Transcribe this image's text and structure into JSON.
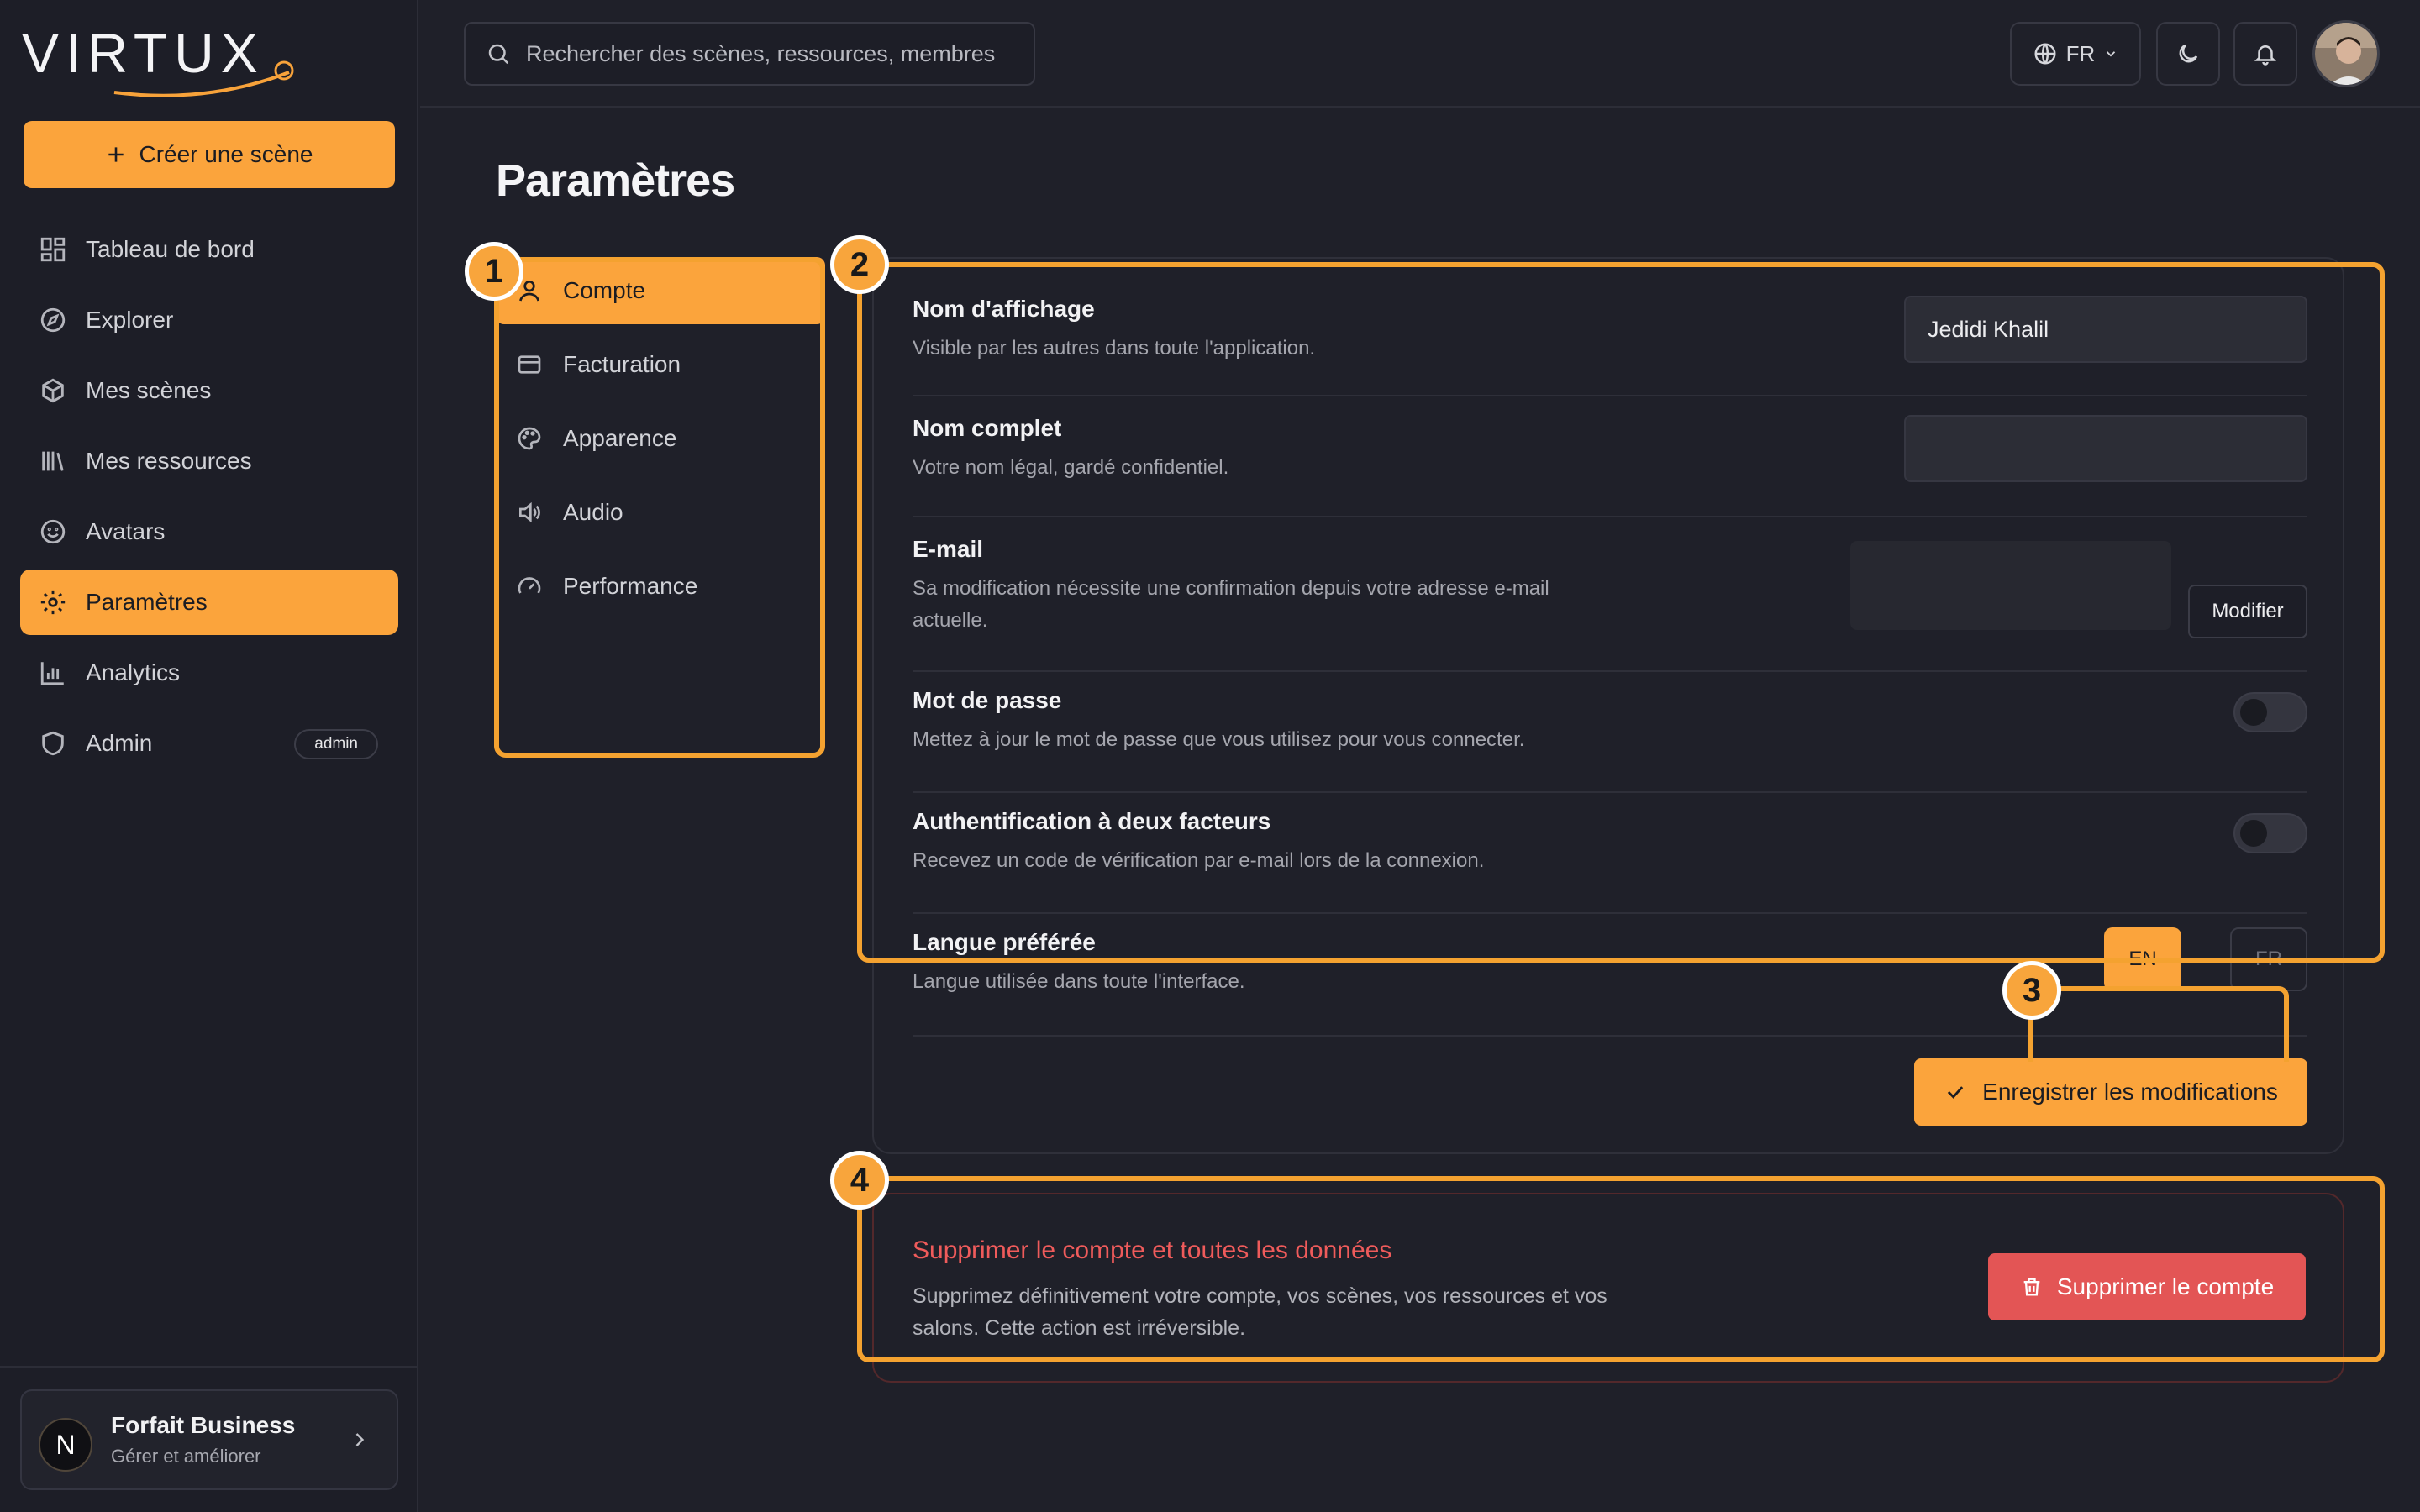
{
  "app": {
    "logo_text": "VIRTUX"
  },
  "sidebar": {
    "create_label": "Créer une scène",
    "items": [
      {
        "label": "Tableau de bord",
        "icon": "dashboard-icon"
      },
      {
        "label": "Explorer",
        "icon": "compass-icon"
      },
      {
        "label": "Mes scènes",
        "icon": "cube-icon"
      },
      {
        "label": "Mes ressources",
        "icon": "library-icon"
      },
      {
        "label": "Avatars",
        "icon": "smile-icon"
      },
      {
        "label": "Paramètres",
        "icon": "gear-icon",
        "active": true
      },
      {
        "label": "Analytics",
        "icon": "bar-chart-icon"
      },
      {
        "label": "Admin",
        "icon": "shield-icon",
        "badge": "admin"
      }
    ],
    "plan": {
      "title": "Forfait Business",
      "subtitle": "Gérer et améliorer",
      "avatar_letter": "N"
    }
  },
  "topbar": {
    "search_placeholder": "Rechercher des scènes, ressources, membres",
    "language": "FR"
  },
  "page": {
    "title": "Paramètres"
  },
  "settings_nav": [
    {
      "label": "Compte",
      "icon": "user-icon",
      "active": true
    },
    {
      "label": "Facturation",
      "icon": "credit-card-icon"
    },
    {
      "label": "Apparence",
      "icon": "palette-icon"
    },
    {
      "label": "Audio",
      "icon": "speaker-icon"
    },
    {
      "label": "Performance",
      "icon": "gauge-icon"
    }
  ],
  "account": {
    "display_name": {
      "title": "Nom d'affichage",
      "desc": "Visible par les autres dans toute l'application.",
      "value": "Jedidi Khalil"
    },
    "full_name": {
      "title": "Nom complet",
      "desc": "Votre nom légal, gardé confidentiel.",
      "value": ""
    },
    "email": {
      "title": "E-mail",
      "desc": "Sa modification nécessite une confirmation depuis votre adresse e-mail actuelle.",
      "button": "Modifier"
    },
    "password": {
      "title": "Mot de passe",
      "desc": "Mettez à jour le mot de passe que vous utilisez pour vous connecter.",
      "enabled": false
    },
    "two_factor": {
      "title": "Authentification à deux facteurs",
      "desc": "Recevez un code de vérification par e-mail lors de la connexion.",
      "enabled": false
    },
    "language": {
      "title": "Langue préférée",
      "desc": "Langue utilisée dans toute l'interface.",
      "options": [
        "EN",
        "FR"
      ],
      "selected": "EN"
    },
    "save_label": "Enregistrer les modifications"
  },
  "danger": {
    "title": "Supprimer le compte et toutes les données",
    "desc": "Supprimez définitivement votre compte, vos scènes, vos ressources et vos salons. Cette action est irréversible.",
    "button": "Supprimer le compte"
  },
  "annotations": [
    "1",
    "2",
    "3",
    "4"
  ],
  "colors": {
    "accent": "#fba43c",
    "danger": "#e35555",
    "background": "#1f2029"
  }
}
